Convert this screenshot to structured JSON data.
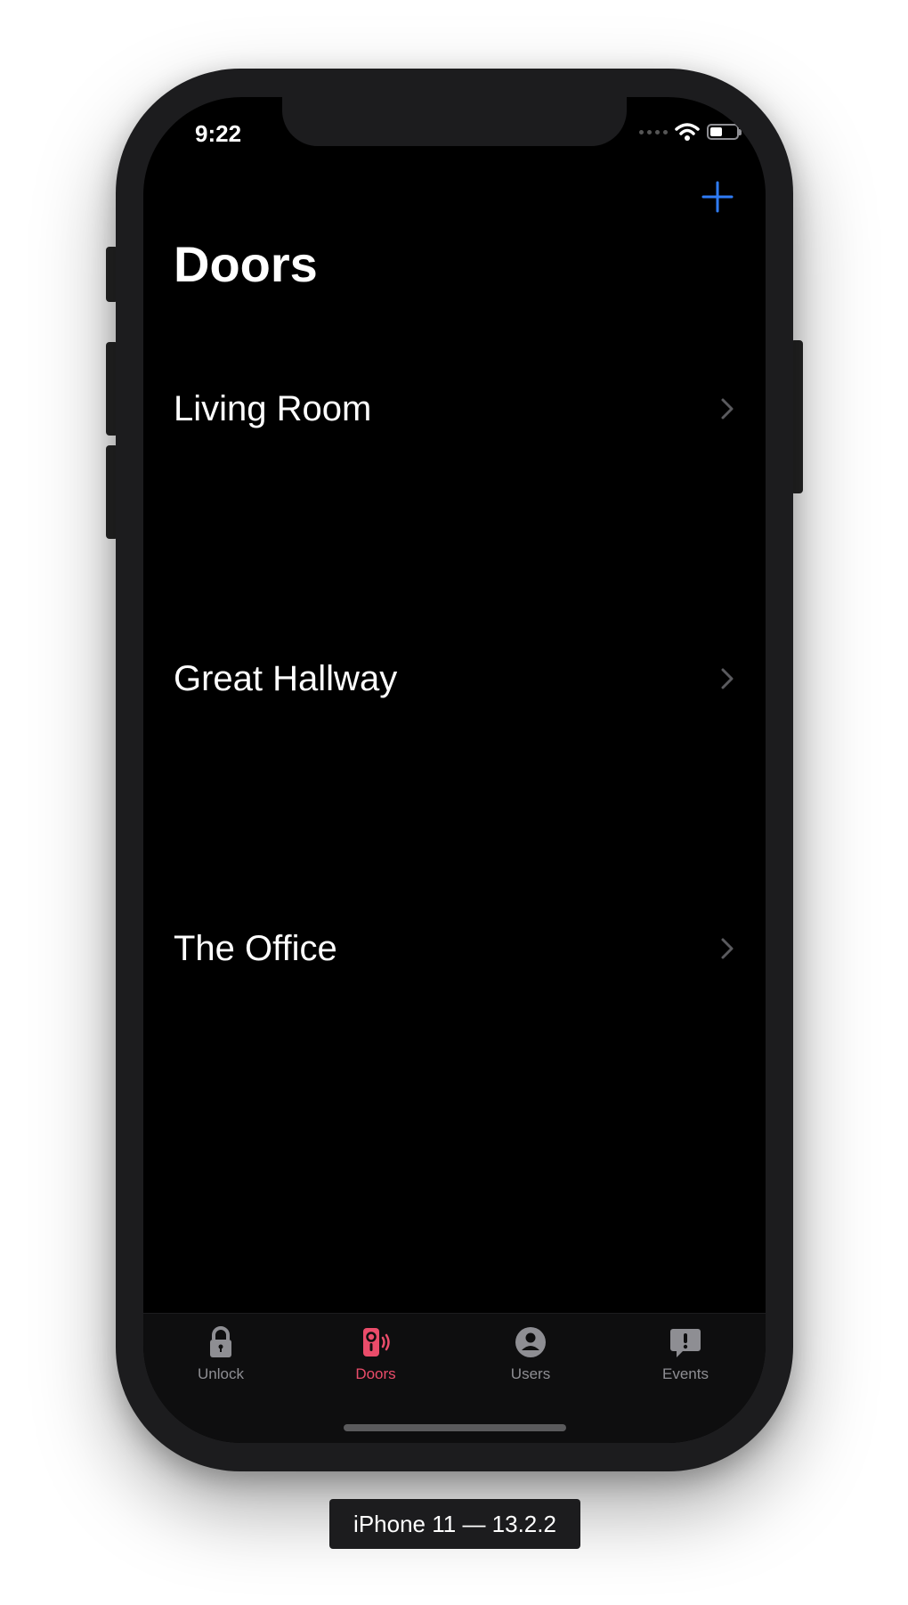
{
  "status_bar": {
    "time": "9:22",
    "battery_level": 0.45
  },
  "nav": {
    "title": "Doors",
    "add_icon": "plus-icon"
  },
  "doors": [
    {
      "label": "Living Room"
    },
    {
      "label": "Great Hallway"
    },
    {
      "label": "The Office"
    }
  ],
  "tabbar": {
    "active_tab": "doors",
    "tabs": [
      {
        "id": "unlock",
        "label": "Unlock",
        "icon": "lock-icon"
      },
      {
        "id": "doors",
        "label": "Doors",
        "icon": "door-intercom-icon"
      },
      {
        "id": "users",
        "label": "Users",
        "icon": "user-circle-icon"
      },
      {
        "id": "events",
        "label": "Events",
        "icon": "alert-bubble-icon"
      }
    ]
  },
  "device_label": "iPhone 11 — 13.2.2",
  "colors": {
    "accent_blue": "#2f7cf6",
    "active_tab": "#ea4c6a",
    "inactive_tab": "#8e8e93",
    "background": "#000000"
  }
}
